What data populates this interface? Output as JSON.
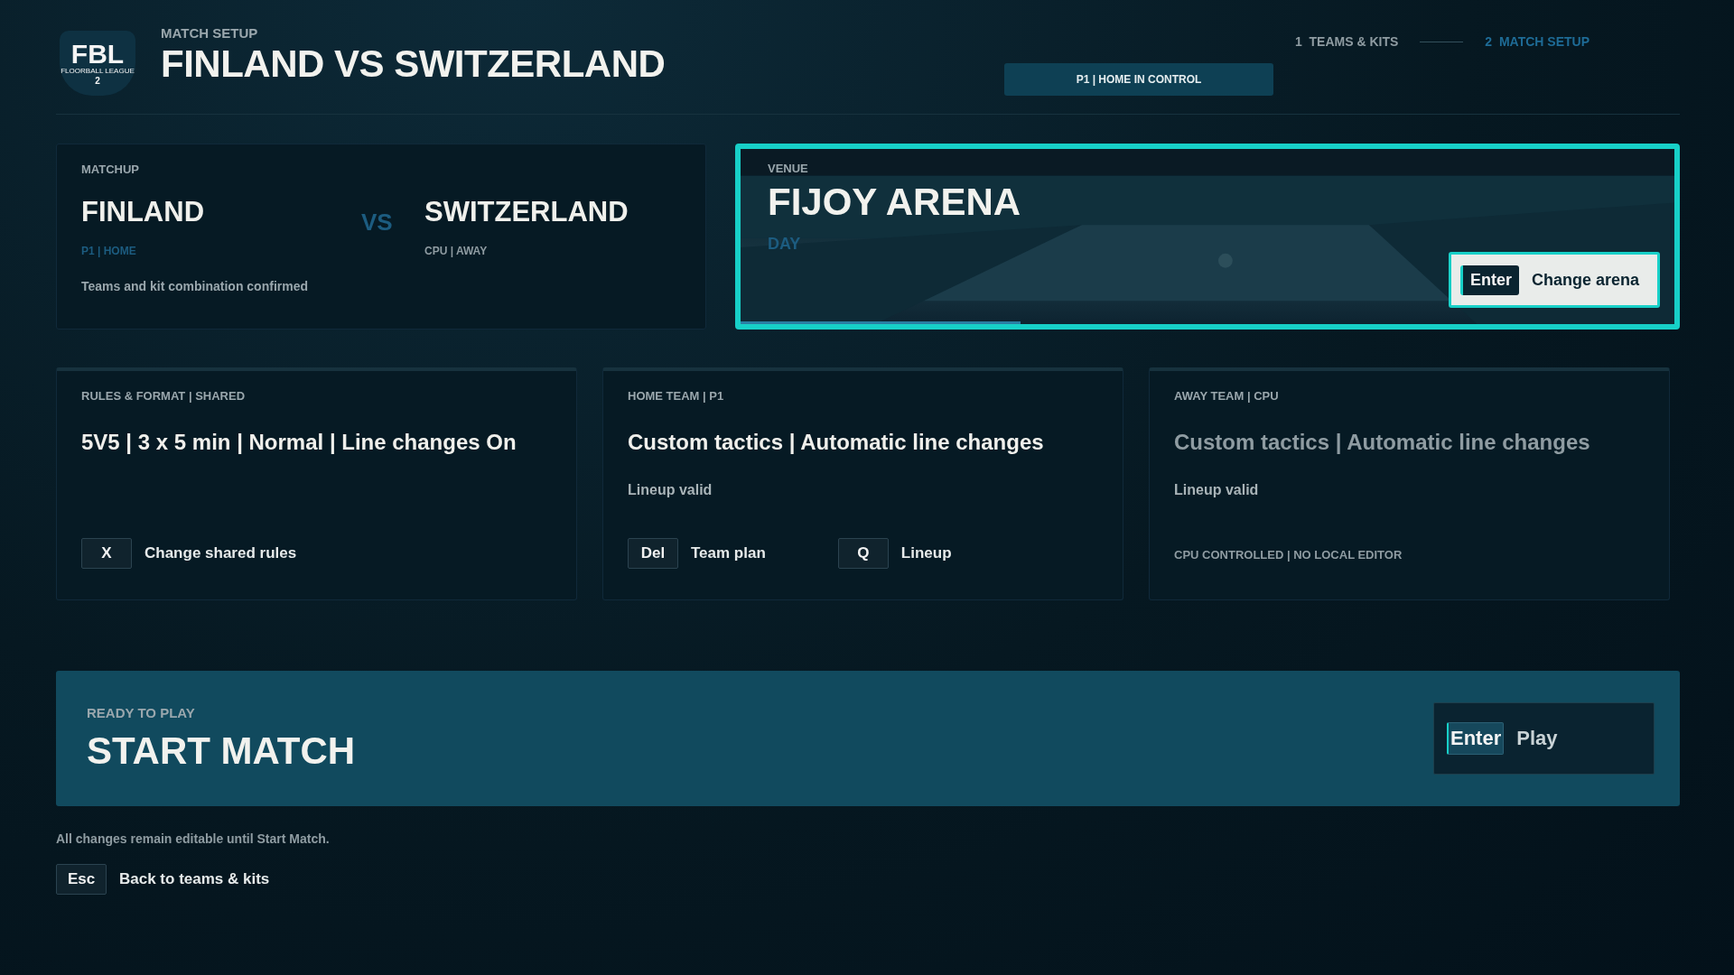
{
  "header": {
    "logo": {
      "text": "FBL",
      "subtitle": "FLOORBALL LEAGUE",
      "number": "2"
    },
    "eyebrow": "MATCH SETUP",
    "title": "FINLAND VS SWITZERLAND"
  },
  "steps": [
    {
      "number": "1",
      "label": "TEAMS & KITS",
      "selected": false
    },
    {
      "number": "2",
      "label": "MATCH SETUP",
      "selected": true
    }
  ],
  "control_badge": "P1 | HOME IN CONTROL",
  "matchup": {
    "label": "MATCHUP",
    "home": {
      "name": "FINLAND",
      "tag": "P1 | HOME"
    },
    "vs": "VS",
    "away": {
      "name": "SWITZERLAND",
      "tag": "CPU | AWAY"
    },
    "note": "Teams and kit combination confirmed"
  },
  "venue": {
    "label": "VENUE",
    "name": "FIJOY ARENA",
    "time": "DAY",
    "focused": true,
    "level": 0.3,
    "action": {
      "key": "Enter",
      "label": "Change arena"
    }
  },
  "cards": [
    {
      "label": "RULES & FORMAT | SHARED",
      "summary": "5V5 | 3 x 5 min | Normal | Line changes On",
      "disabled": false,
      "actions": [
        {
          "key": "X",
          "label": "Change shared rules"
        }
      ]
    },
    {
      "label": "HOME TEAM | P1",
      "summary": "Custom tactics | Automatic line changes",
      "status": "Lineup valid",
      "disabled": false,
      "actions": [
        {
          "key": "Del",
          "label": "Team plan"
        },
        {
          "key": "Q",
          "label": "Lineup"
        }
      ]
    },
    {
      "label": "AWAY TEAM | CPU",
      "summary": "Custom tactics | Automatic line changes",
      "status": "Lineup valid",
      "disabled": true,
      "note": "CPU CONTROLLED | NO LOCAL EDITOR"
    }
  ],
  "start": {
    "eyebrow": "READY TO PLAY",
    "title": "START MATCH",
    "action": {
      "key": "Enter",
      "label": "Play"
    }
  },
  "footer": {
    "note": "All changes remain editable until Start Match.",
    "back": {
      "key": "Esc",
      "label": "Back to teams & kits"
    }
  }
}
